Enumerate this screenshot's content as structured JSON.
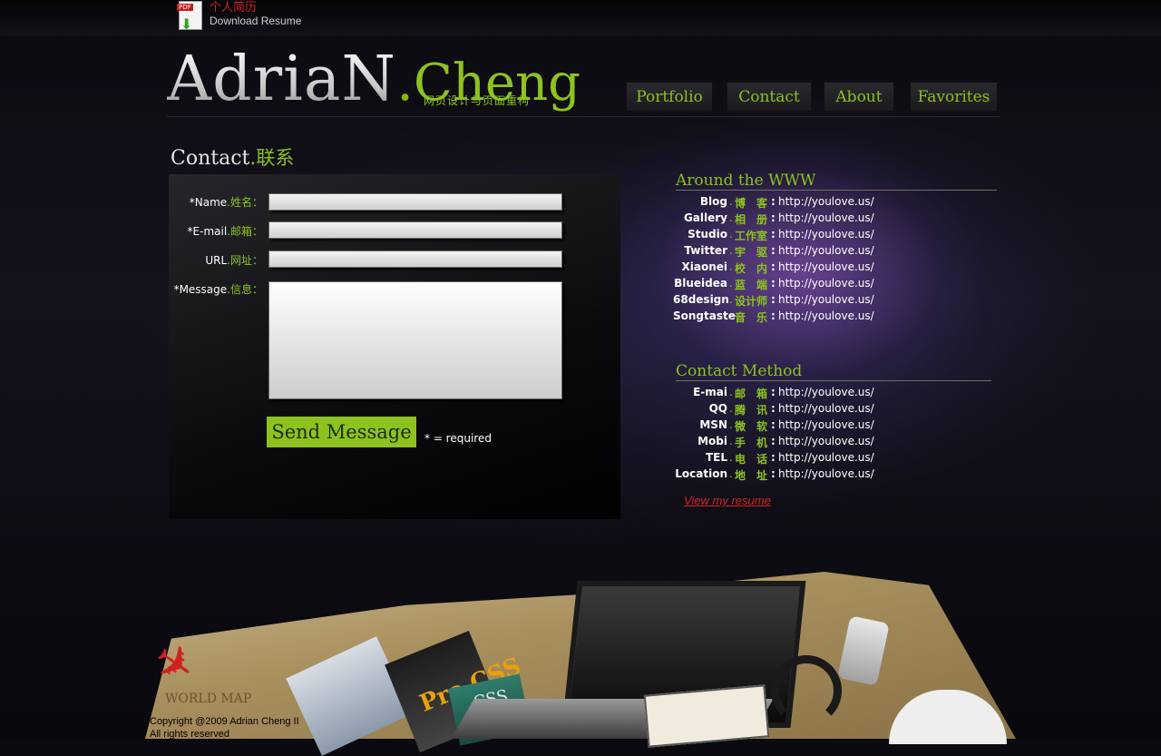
{
  "resume": {
    "cn": "个人简历",
    "en": "Download Resume",
    "pdf_tag": "PDF"
  },
  "logo": {
    "name": "AdriaN",
    "dot": ".",
    "cheng": "Cheng",
    "subtitle": "网页设计与页面重构"
  },
  "nav": [
    {
      "label": "Portfolio"
    },
    {
      "label": "Contact"
    },
    {
      "label": "About"
    },
    {
      "label": "Favorites"
    }
  ],
  "contact_title": {
    "en": "Contact",
    "dot": ".",
    "cn": "联系"
  },
  "form": {
    "fields": [
      {
        "en": "*Name",
        "dot": ".",
        "cn": "姓名：",
        "value": ""
      },
      {
        "en": "*E-mail",
        "dot": ".",
        "cn": "邮箱：",
        "value": ""
      },
      {
        "en": "URL",
        "dot": ".",
        "cn": "网址：",
        "value": ""
      },
      {
        "en": "*Message",
        "dot": ".",
        "cn": "信息：",
        "value": ""
      }
    ],
    "send_label": "Send Message",
    "required_note": "* = required"
  },
  "around": {
    "heading": "Around the WWW",
    "rows": [
      {
        "label": "Blog",
        "cn": "博　客",
        "url": "http://youlove.us/"
      },
      {
        "label": "Gallery",
        "cn": "相　册",
        "url": "http://youlove.us/"
      },
      {
        "label": "Studio",
        "cn": "工作室",
        "url": "http://youlove.us/"
      },
      {
        "label": "Twitter",
        "cn": "宇　驱",
        "url": "http://youlove.us/"
      },
      {
        "label": "Xiaonei",
        "cn": "校　内",
        "url": "http://youlove.us/"
      },
      {
        "label": "Blueidea",
        "cn": "蓝　端",
        "url": "http://youlove.us/"
      },
      {
        "label": "68design",
        "cn": "设计师",
        "url": "http://youlove.us/"
      },
      {
        "label": "Songtaste",
        "cn": "音　乐",
        "url": "http://youlove.us/"
      }
    ]
  },
  "contact_method": {
    "heading": "Contact Method",
    "rows": [
      {
        "label": "E-mai",
        "cn": "邮　箱",
        "url": "http://youlove.us/"
      },
      {
        "label": "QQ",
        "cn": "腾　讯",
        "url": "http://youlove.us/"
      },
      {
        "label": "MSN",
        "cn": "微　软",
        "url": "http://youlove.us/"
      },
      {
        "label": "Mobi",
        "cn": "手　机",
        "url": "http://youlove.us/"
      },
      {
        "label": "TEL",
        "cn": "电　话",
        "url": "http://youlove.us/"
      },
      {
        "label": "Location",
        "cn": "地　址",
        "url": "http://youlove.us/"
      }
    ]
  },
  "view_resume": "View my resume",
  "desk": {
    "map_text": "WORLD MAP",
    "book_css": "CSS",
    "book_pro": "Pro CSS"
  },
  "footer": {
    "copyright": "Copyright @2009 Adrian Cheng II",
    "rights": "All rights reserved"
  },
  "colors": {
    "accent": "#8dc21f",
    "resume_red": "#d42323",
    "background": "#0d0c13"
  }
}
